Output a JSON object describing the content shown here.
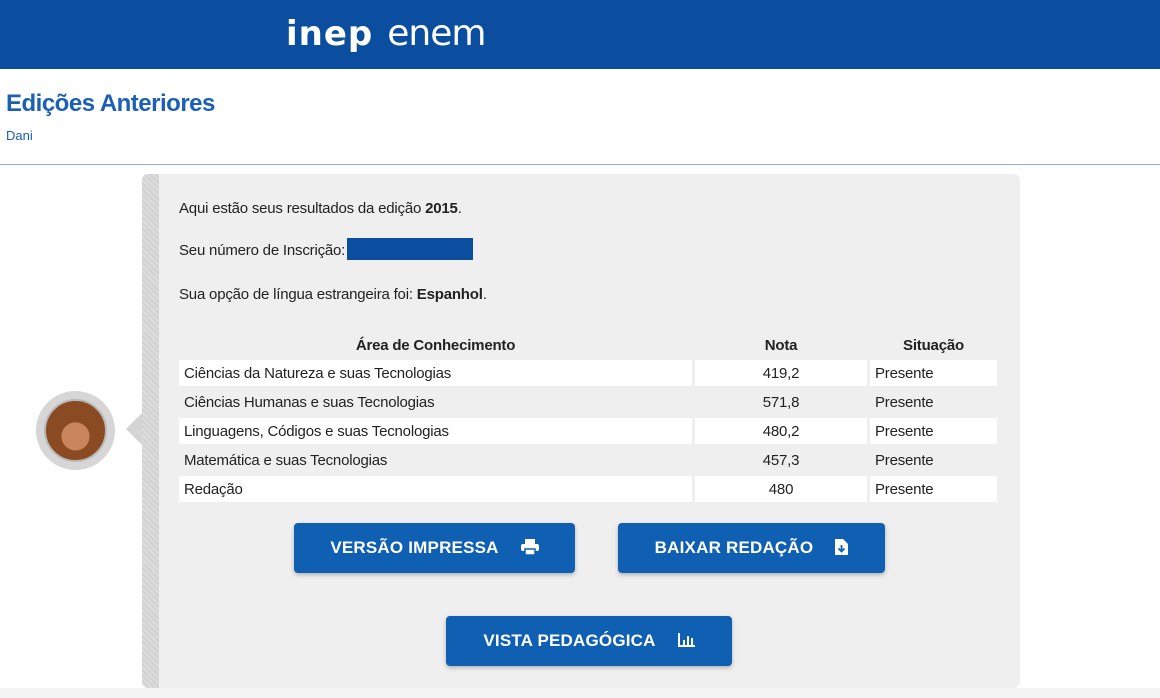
{
  "header": {
    "brand_inep": "inep",
    "brand_enem": "enem",
    "bg_color": "#0b4ea0"
  },
  "page": {
    "title": "Edições Anteriores",
    "user": "Dani"
  },
  "results": {
    "intro_prefix": "Aqui estão seus resultados da edição ",
    "edition": "2015",
    "intro_suffix": ".",
    "registration_label": "Seu número de Inscrição:",
    "language_prefix": "Sua opção de língua estrangeira foi: ",
    "language": "Espanhol",
    "language_suffix": "."
  },
  "table": {
    "headers": {
      "area": "Área de Conhecimento",
      "nota": "Nota",
      "situacao": "Situação"
    },
    "rows": [
      {
        "area": "Ciências da Natureza e suas Tecnologias",
        "nota": "419,2",
        "situacao": "Presente"
      },
      {
        "area": "Ciências Humanas e suas Tecnologias",
        "nota": "571,8",
        "situacao": "Presente"
      },
      {
        "area": "Linguagens, Códigos e suas Tecnologias",
        "nota": "480,2",
        "situacao": "Presente"
      },
      {
        "area": "Matemática e suas Tecnologias",
        "nota": "457,3",
        "situacao": "Presente"
      },
      {
        "area": "Redação",
        "nota": "480",
        "situacao": "Presente"
      }
    ]
  },
  "buttons": {
    "print": {
      "label": "VERSÃO IMPRESSA",
      "icon": "printer-icon"
    },
    "download": {
      "label": "BAIXAR REDAÇÃO",
      "icon": "file-download-icon"
    },
    "vista": {
      "label": "VISTA PEDAGÓGICA",
      "icon": "bar-chart-icon"
    }
  },
  "colors": {
    "primary": "#0f5fb3",
    "title": "#1b5fb6",
    "card_bg": "#efefef"
  }
}
